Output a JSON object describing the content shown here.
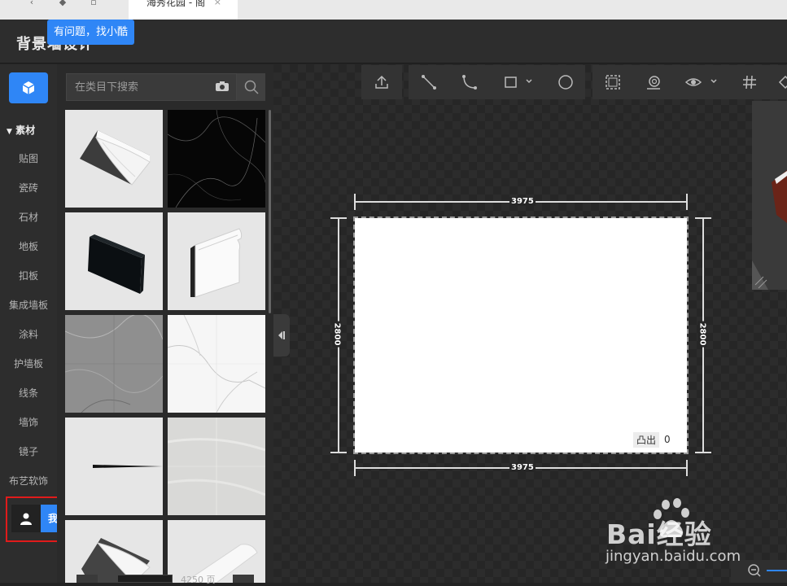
{
  "browser": {
    "tab_title": "海秀花园 - 阁",
    "tab_close": "×"
  },
  "app": {
    "title": "背景墙设计",
    "help_tip": "有问题，找小酷"
  },
  "nav": {
    "section_label": "素材",
    "items": [
      "贴图",
      "瓷砖",
      "石材",
      "地板",
      "扣板",
      "集成墙板",
      "涂料",
      "护墙板",
      "线条",
      "墙饰",
      "镜子",
      "布艺软饰"
    ],
    "mine_label": "我的"
  },
  "search": {
    "placeholder": "在类目下搜索"
  },
  "materials": [
    {
      "name": "crown-molding-thumbnail",
      "kind": "crown"
    },
    {
      "name": "black-marble-thumbnail",
      "kind": "black-marble"
    },
    {
      "name": "black-panel-thumbnail",
      "kind": "black-panel"
    },
    {
      "name": "baseboard-thumbnail",
      "kind": "baseboard"
    },
    {
      "name": "grey-marble-thumbnail",
      "kind": "grey-marble"
    },
    {
      "name": "white-marble-thumbnail",
      "kind": "white-marble"
    },
    {
      "name": "thin-strip-thumbnail",
      "kind": "strip"
    },
    {
      "name": "light-stone-thumbnail",
      "kind": "light-stone"
    },
    {
      "name": "crown-molding-2-thumbnail",
      "kind": "crown2"
    },
    {
      "name": "molding-3-thumbnail",
      "kind": "molding3"
    }
  ],
  "pager": {
    "total_text": "4250 页"
  },
  "canvas": {
    "width_dim": "3975",
    "height_dim": "2800",
    "protrude_label": "凸出",
    "protrude_value": "0"
  },
  "toolbar": {
    "icons": [
      "upload-icon",
      "line-icon",
      "arc-icon",
      "rectangle-icon",
      "circle-icon",
      "select-area-icon",
      "camera-icon",
      "eye-icon",
      "grid-icon"
    ]
  },
  "watermark": {
    "main": "Bai经验",
    "sub": "jingyan.baidu.com"
  },
  "colors": {
    "accent": "#2f86f6",
    "highlight": "#e01b1b"
  }
}
